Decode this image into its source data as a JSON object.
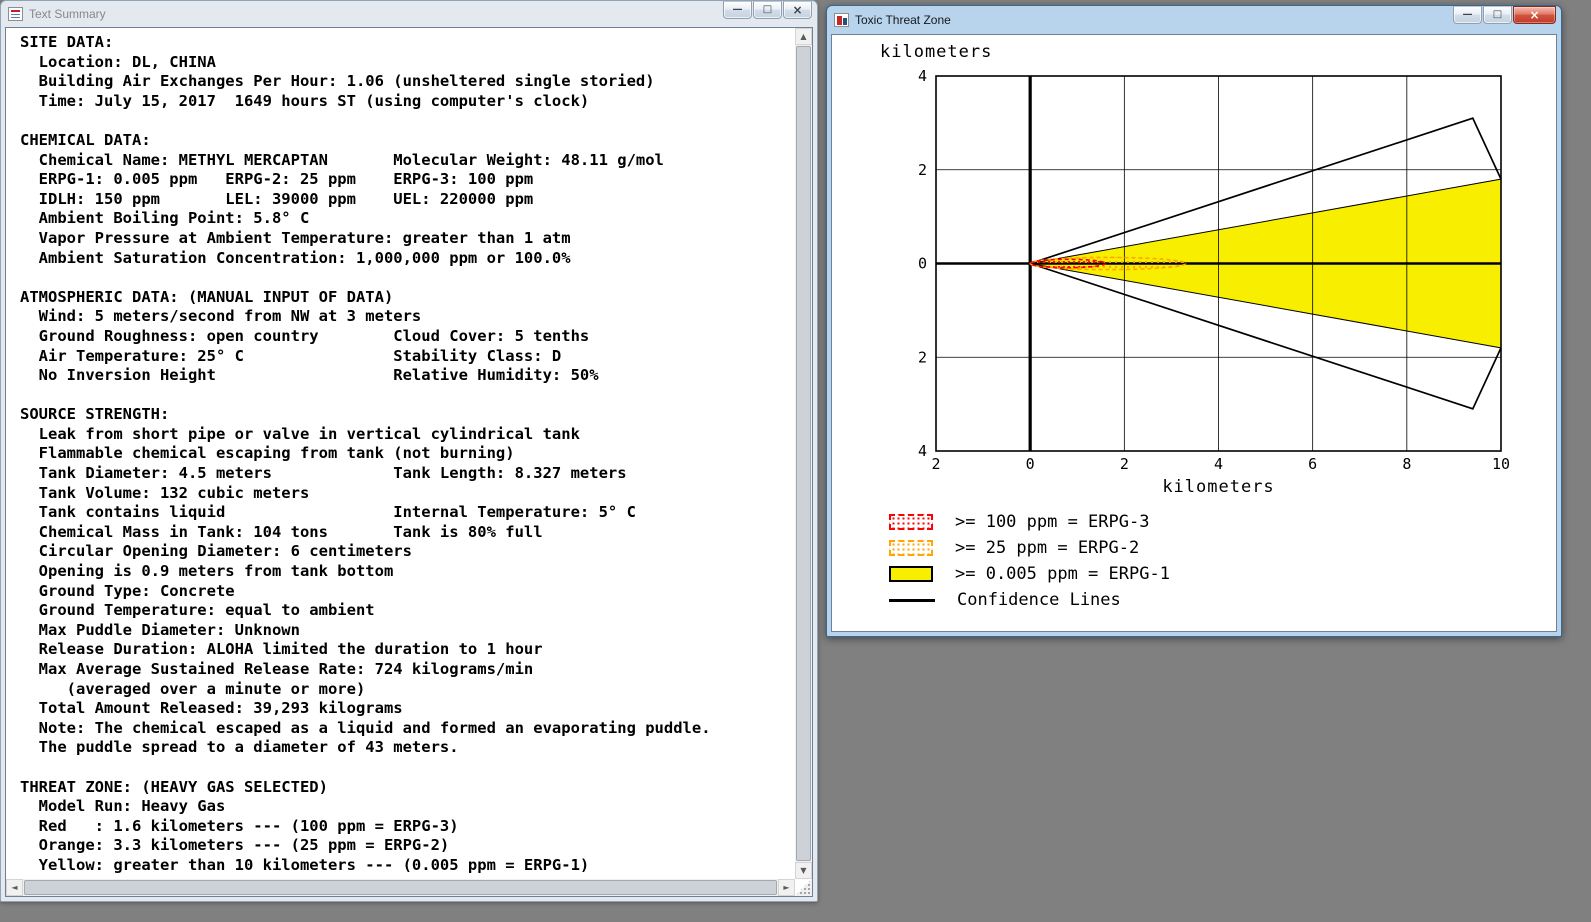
{
  "desktop": {
    "background": "#808080"
  },
  "windows": {
    "text_summary": {
      "title": "Text Summary",
      "lines": [
        "SITE DATA:",
        "  Location: DL, CHINA",
        "  Building Air Exchanges Per Hour: 1.06 (unsheltered single storied)",
        "  Time: July 15, 2017  1649 hours ST (using computer's clock)",
        "",
        "CHEMICAL DATA:",
        "  Chemical Name: METHYL MERCAPTAN       Molecular Weight: 48.11 g/mol",
        "  ERPG-1: 0.005 ppm   ERPG-2: 25 ppm    ERPG-3: 100 ppm",
        "  IDLH: 150 ppm       LEL: 39000 ppm    UEL: 220000 ppm",
        "  Ambient Boiling Point: 5.8° C",
        "  Vapor Pressure at Ambient Temperature: greater than 1 atm",
        "  Ambient Saturation Concentration: 1,000,000 ppm or 100.0%",
        "",
        "ATMOSPHERIC DATA: (MANUAL INPUT OF DATA)",
        "  Wind: 5 meters/second from NW at 3 meters",
        "  Ground Roughness: open country        Cloud Cover: 5 tenths",
        "  Air Temperature: 25° C                Stability Class: D",
        "  No Inversion Height                   Relative Humidity: 50%",
        "",
        "SOURCE STRENGTH:",
        "  Leak from short pipe or valve in vertical cylindrical tank",
        "  Flammable chemical escaping from tank (not burning)",
        "  Tank Diameter: 4.5 meters             Tank Length: 8.327 meters",
        "  Tank Volume: 132 cubic meters",
        "  Tank contains liquid                  Internal Temperature: 5° C",
        "  Chemical Mass in Tank: 104 tons       Tank is 80% full",
        "  Circular Opening Diameter: 6 centimeters",
        "  Opening is 0.9 meters from tank bottom",
        "  Ground Type: Concrete",
        "  Ground Temperature: equal to ambient",
        "  Max Puddle Diameter: Unknown",
        "  Release Duration: ALOHA limited the duration to 1 hour",
        "  Max Average Sustained Release Rate: 724 kilograms/min",
        "     (averaged over a minute or more)",
        "  Total Amount Released: 39,293 kilograms",
        "  Note: The chemical escaped as a liquid and formed an evaporating puddle.",
        "  The puddle spread to a diameter of 43 meters.",
        "",
        "THREAT ZONE: (HEAVY GAS SELECTED)",
        "  Model Run: Heavy Gas",
        "  Red   : 1.6 kilometers --- (100 ppm = ERPG-3)",
        "  Orange: 3.3 kilometers --- (25 ppm = ERPG-2)",
        "  Yellow: greater than 10 kilometers --- (0.005 ppm = ERPG-1)"
      ]
    },
    "threat_zone": {
      "title": "Toxic Threat Zone"
    }
  },
  "icons": {
    "minimize": "—",
    "maximize": "□",
    "close": "×",
    "scroll_up": "▲",
    "scroll_down": "▼",
    "scroll_left": "◄",
    "scroll_right": "►"
  },
  "chart_data": {
    "type": "area",
    "title": "Toxic Threat Zone",
    "xlabel": "kilometers",
    "ylabel": "kilometers",
    "xlim": [
      -2,
      10
    ],
    "ylim": [
      -4,
      4
    ],
    "xticks": [
      -2,
      0,
      2,
      4,
      6,
      8,
      10
    ],
    "xtick_labels": [
      "2",
      "0",
      "2",
      "4",
      "6",
      "8",
      "10"
    ],
    "yticks": [
      4,
      2,
      0,
      -2,
      -4
    ],
    "ytick_labels": [
      "4",
      "2",
      "0",
      "2",
      "4"
    ],
    "grid": true,
    "zones": {
      "red": {
        "label": ">= 100 ppm = ERPG-3",
        "color": "#ff0000",
        "extent_km": 1.6,
        "half_width_km": 0.09
      },
      "orange": {
        "label": ">= 25 ppm = ERPG-2",
        "color": "#ffa500",
        "extent_km": 3.3,
        "half_width_km": 0.13
      },
      "yellow": {
        "label": ">= 0.005 ppm = ERPG-1",
        "color": "#f8ee00",
        "extent_km": 10,
        "polygon_km": [
          [
            0,
            0
          ],
          [
            10,
            1.8
          ],
          [
            10,
            -1.8
          ]
        ]
      }
    },
    "confidence_lines": {
      "label": "Confidence Lines",
      "color": "#000000",
      "top_km": [
        [
          0,
          0
        ],
        [
          9.4,
          3.1
        ],
        [
          10,
          1.8
        ]
      ],
      "bottom_km": [
        [
          0,
          0
        ],
        [
          9.4,
          -3.1
        ],
        [
          10,
          -1.8
        ]
      ]
    },
    "legend": [
      {
        "key": "red",
        "label": ">= 100 ppm = ERPG-3"
      },
      {
        "key": "orange",
        "label": ">= 25 ppm = ERPG-2"
      },
      {
        "key": "yellow",
        "label": ">= 0.005 ppm = ERPG-1"
      },
      {
        "key": "confidence",
        "label": "Confidence Lines"
      }
    ]
  }
}
